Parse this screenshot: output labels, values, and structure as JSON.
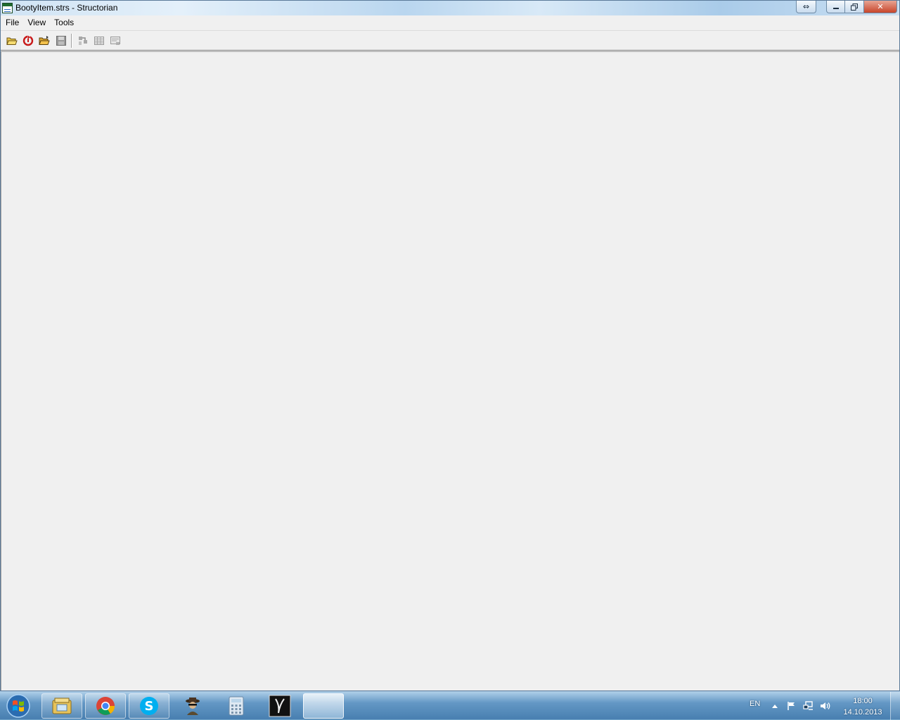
{
  "window": {
    "title": "BootyItem.strs - Structorian",
    "icon": "structorian-app-icon"
  },
  "caption_buttons": {
    "extra": "⇔",
    "minimize": "minimize-icon",
    "maximize": "restore-icon",
    "close": "✕"
  },
  "menu": {
    "items": [
      {
        "label": "File"
      },
      {
        "label": "View"
      },
      {
        "label": "Tools"
      }
    ]
  },
  "toolbar": {
    "buttons": [
      {
        "icon": "open-folder-icon",
        "enabled": true
      },
      {
        "icon": "reload-icon",
        "enabled": true
      },
      {
        "icon": "open-data-icon",
        "enabled": true
      },
      {
        "icon": "save-icon",
        "enabled": false
      },
      {
        "icon": "go-to-structure-icon",
        "enabled": false
      },
      {
        "icon": "table-view-icon",
        "enabled": false
      },
      {
        "icon": "export-icon",
        "enabled": false
      }
    ]
  },
  "taskbar": {
    "apps": [
      {
        "name": "windows-explorer"
      },
      {
        "name": "google-chrome"
      },
      {
        "name": "skype"
      },
      {
        "name": "spy-app"
      },
      {
        "name": "calculator"
      },
      {
        "name": "dark-app"
      },
      {
        "name": "structorian"
      }
    ],
    "language": "EN",
    "time": "18:00",
    "date": "14.10.2013"
  },
  "colors": {
    "window_bg": "#f0f0f0",
    "close_button": "#c7452b",
    "taskbar": "#467daf"
  }
}
